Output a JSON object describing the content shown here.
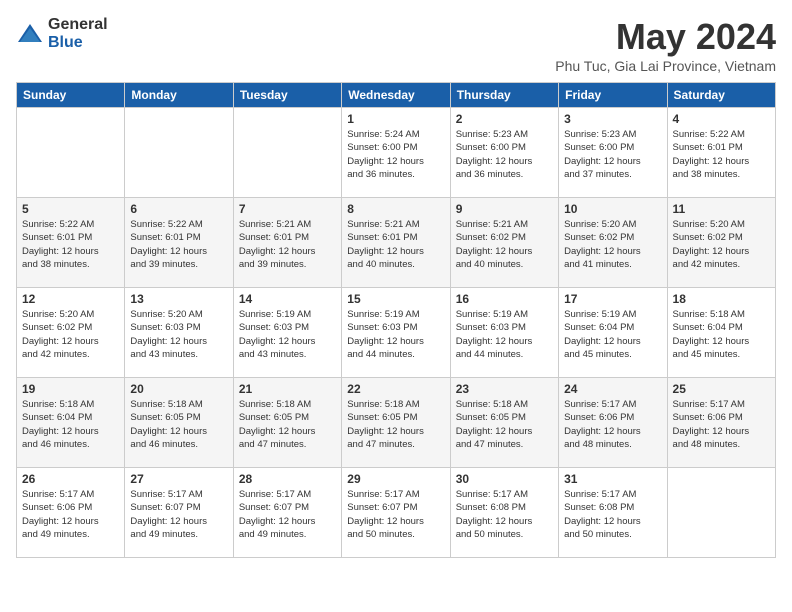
{
  "header": {
    "logo": {
      "general": "General",
      "blue": "Blue"
    },
    "title": "May 2024",
    "location": "Phu Tuc, Gia Lai Province, Vietnam"
  },
  "weekdays": [
    "Sunday",
    "Monday",
    "Tuesday",
    "Wednesday",
    "Thursday",
    "Friday",
    "Saturday"
  ],
  "weeks": [
    [
      {
        "day": "",
        "info": ""
      },
      {
        "day": "",
        "info": ""
      },
      {
        "day": "",
        "info": ""
      },
      {
        "day": "1",
        "info": "Sunrise: 5:24 AM\nSunset: 6:00 PM\nDaylight: 12 hours\nand 36 minutes."
      },
      {
        "day": "2",
        "info": "Sunrise: 5:23 AM\nSunset: 6:00 PM\nDaylight: 12 hours\nand 36 minutes."
      },
      {
        "day": "3",
        "info": "Sunrise: 5:23 AM\nSunset: 6:00 PM\nDaylight: 12 hours\nand 37 minutes."
      },
      {
        "day": "4",
        "info": "Sunrise: 5:22 AM\nSunset: 6:01 PM\nDaylight: 12 hours\nand 38 minutes."
      }
    ],
    [
      {
        "day": "5",
        "info": "Sunrise: 5:22 AM\nSunset: 6:01 PM\nDaylight: 12 hours\nand 38 minutes."
      },
      {
        "day": "6",
        "info": "Sunrise: 5:22 AM\nSunset: 6:01 PM\nDaylight: 12 hours\nand 39 minutes."
      },
      {
        "day": "7",
        "info": "Sunrise: 5:21 AM\nSunset: 6:01 PM\nDaylight: 12 hours\nand 39 minutes."
      },
      {
        "day": "8",
        "info": "Sunrise: 5:21 AM\nSunset: 6:01 PM\nDaylight: 12 hours\nand 40 minutes."
      },
      {
        "day": "9",
        "info": "Sunrise: 5:21 AM\nSunset: 6:02 PM\nDaylight: 12 hours\nand 40 minutes."
      },
      {
        "day": "10",
        "info": "Sunrise: 5:20 AM\nSunset: 6:02 PM\nDaylight: 12 hours\nand 41 minutes."
      },
      {
        "day": "11",
        "info": "Sunrise: 5:20 AM\nSunset: 6:02 PM\nDaylight: 12 hours\nand 42 minutes."
      }
    ],
    [
      {
        "day": "12",
        "info": "Sunrise: 5:20 AM\nSunset: 6:02 PM\nDaylight: 12 hours\nand 42 minutes."
      },
      {
        "day": "13",
        "info": "Sunrise: 5:20 AM\nSunset: 6:03 PM\nDaylight: 12 hours\nand 43 minutes."
      },
      {
        "day": "14",
        "info": "Sunrise: 5:19 AM\nSunset: 6:03 PM\nDaylight: 12 hours\nand 43 minutes."
      },
      {
        "day": "15",
        "info": "Sunrise: 5:19 AM\nSunset: 6:03 PM\nDaylight: 12 hours\nand 44 minutes."
      },
      {
        "day": "16",
        "info": "Sunrise: 5:19 AM\nSunset: 6:03 PM\nDaylight: 12 hours\nand 44 minutes."
      },
      {
        "day": "17",
        "info": "Sunrise: 5:19 AM\nSunset: 6:04 PM\nDaylight: 12 hours\nand 45 minutes."
      },
      {
        "day": "18",
        "info": "Sunrise: 5:18 AM\nSunset: 6:04 PM\nDaylight: 12 hours\nand 45 minutes."
      }
    ],
    [
      {
        "day": "19",
        "info": "Sunrise: 5:18 AM\nSunset: 6:04 PM\nDaylight: 12 hours\nand 46 minutes."
      },
      {
        "day": "20",
        "info": "Sunrise: 5:18 AM\nSunset: 6:05 PM\nDaylight: 12 hours\nand 46 minutes."
      },
      {
        "day": "21",
        "info": "Sunrise: 5:18 AM\nSunset: 6:05 PM\nDaylight: 12 hours\nand 47 minutes."
      },
      {
        "day": "22",
        "info": "Sunrise: 5:18 AM\nSunset: 6:05 PM\nDaylight: 12 hours\nand 47 minutes."
      },
      {
        "day": "23",
        "info": "Sunrise: 5:18 AM\nSunset: 6:05 PM\nDaylight: 12 hours\nand 47 minutes."
      },
      {
        "day": "24",
        "info": "Sunrise: 5:17 AM\nSunset: 6:06 PM\nDaylight: 12 hours\nand 48 minutes."
      },
      {
        "day": "25",
        "info": "Sunrise: 5:17 AM\nSunset: 6:06 PM\nDaylight: 12 hours\nand 48 minutes."
      }
    ],
    [
      {
        "day": "26",
        "info": "Sunrise: 5:17 AM\nSunset: 6:06 PM\nDaylight: 12 hours\nand 49 minutes."
      },
      {
        "day": "27",
        "info": "Sunrise: 5:17 AM\nSunset: 6:07 PM\nDaylight: 12 hours\nand 49 minutes."
      },
      {
        "day": "28",
        "info": "Sunrise: 5:17 AM\nSunset: 6:07 PM\nDaylight: 12 hours\nand 49 minutes."
      },
      {
        "day": "29",
        "info": "Sunrise: 5:17 AM\nSunset: 6:07 PM\nDaylight: 12 hours\nand 50 minutes."
      },
      {
        "day": "30",
        "info": "Sunrise: 5:17 AM\nSunset: 6:08 PM\nDaylight: 12 hours\nand 50 minutes."
      },
      {
        "day": "31",
        "info": "Sunrise: 5:17 AM\nSunset: 6:08 PM\nDaylight: 12 hours\nand 50 minutes."
      },
      {
        "day": "",
        "info": ""
      }
    ]
  ]
}
